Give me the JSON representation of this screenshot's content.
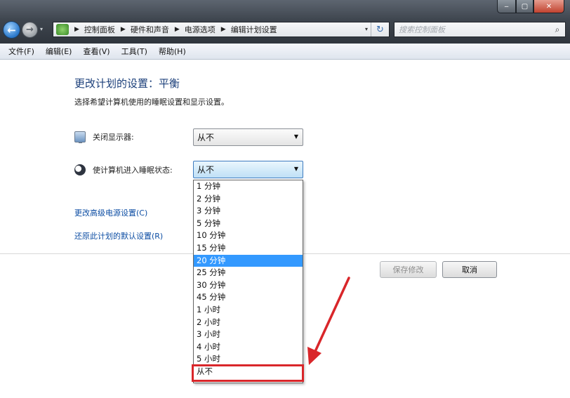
{
  "window": {
    "minimize_glyph": "‒",
    "maximize_glyph": "▢",
    "close_glyph": "✕"
  },
  "nav": {
    "back_glyph": "←",
    "forward_glyph": "→",
    "dropdown_glyph": "▾"
  },
  "address": {
    "breadcrumbs": [
      "控制面板",
      "硬件和声音",
      "电源选项",
      "编辑计划设置"
    ],
    "separator": "▶",
    "dropdown_glyph": "▾",
    "refresh_glyph": "↻"
  },
  "search": {
    "placeholder": "搜索控制面板",
    "icon": "search-icon"
  },
  "menu": {
    "items": [
      "文件(F)",
      "编辑(E)",
      "查看(V)",
      "工具(T)",
      "帮助(H)"
    ]
  },
  "page": {
    "title": "更改计划的设置：平衡",
    "subtitle": "选择希望计算机使用的睡眠设置和显示设置。"
  },
  "settings": {
    "display_off": {
      "label": "关闭显示器:",
      "value": "从不",
      "icon": "display-icon"
    },
    "sleep": {
      "label": "使计算机进入睡眠状态:",
      "value": "从不",
      "icon": "sleep-icon"
    }
  },
  "links": {
    "advanced": "更改高级电源设置(C)",
    "restore": "还原此计划的默认设置(R)"
  },
  "buttons": {
    "save": "保存修改",
    "cancel": "取消"
  },
  "dropdown": {
    "options": [
      "1 分钟",
      "2 分钟",
      "3 分钟",
      "5 分钟",
      "10 分钟",
      "15 分钟",
      "20 分钟",
      "25 分钟",
      "30 分钟",
      "45 分钟",
      "1 小时",
      "2 小时",
      "3 小时",
      "4 小时",
      "5 小时",
      "从不"
    ],
    "highlighted": "20 分钟"
  },
  "annotation": {
    "color": "#d9262a"
  }
}
